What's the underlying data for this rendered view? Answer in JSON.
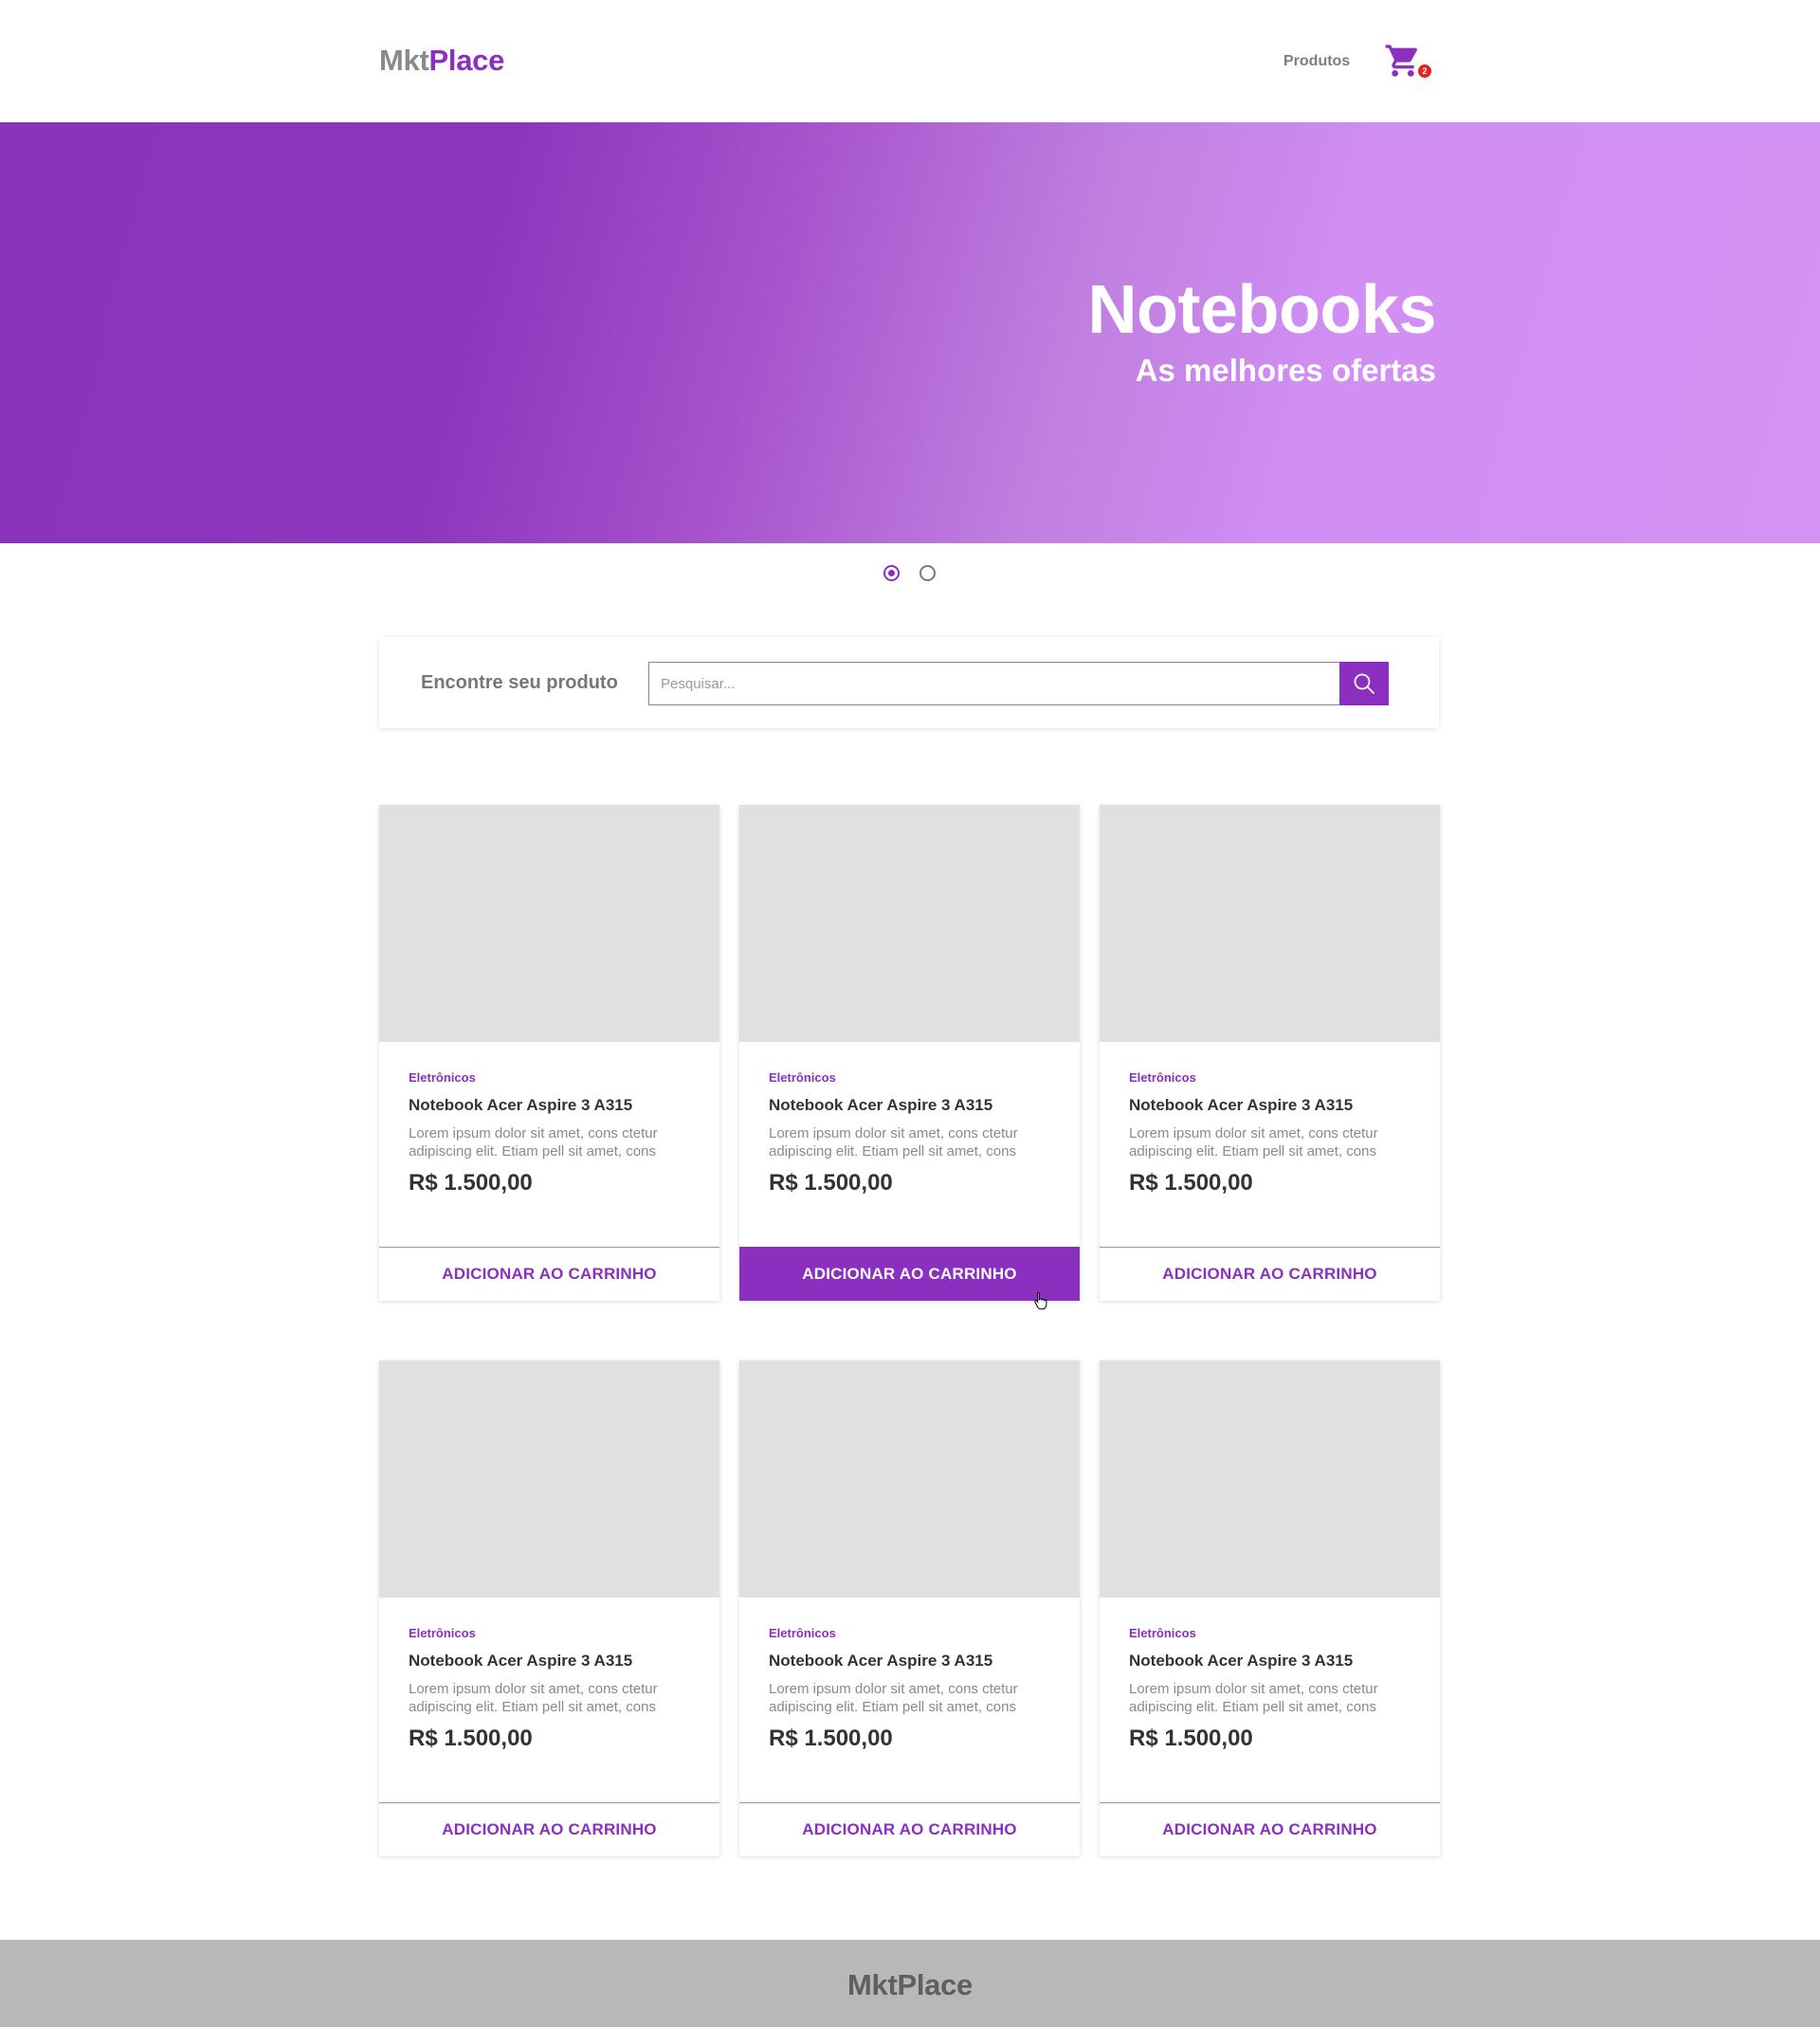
{
  "header": {
    "logo_part1": "Mkt",
    "logo_part2": "Place",
    "nav_products": "Produtos",
    "cart_count": "2"
  },
  "hero": {
    "title": "Notebooks",
    "subtitle": "As melhores ofertas",
    "slides": 2,
    "active_slide": 1
  },
  "search": {
    "label": "Encontre seu produto",
    "placeholder": "Pesquisar..."
  },
  "products": [
    {
      "category": "Eletrônicos",
      "title": "Notebook Acer Aspire 3 A315",
      "description": "Lorem ipsum dolor sit amet, cons ctetur adipiscing elit. Etiam pell sit amet, cons",
      "price": "R$ 1.500,00",
      "button": "ADICIONAR AO CARRINHO"
    },
    {
      "category": "Eletrônicos",
      "title": "Notebook Acer Aspire 3 A315",
      "description": "Lorem ipsum dolor sit amet, cons ctetur adipiscing elit. Etiam pell sit amet, cons",
      "price": "R$ 1.500,00",
      "button": "ADICIONAR AO CARRINHO"
    },
    {
      "category": "Eletrônicos",
      "title": "Notebook Acer Aspire 3 A315",
      "description": "Lorem ipsum dolor sit amet, cons ctetur adipiscing elit. Etiam pell sit amet, cons",
      "price": "R$ 1.500,00",
      "button": "ADICIONAR AO CARRINHO"
    },
    {
      "category": "Eletrônicos",
      "title": "Notebook Acer Aspire 3 A315",
      "description": "Lorem ipsum dolor sit amet, cons ctetur adipiscing elit. Etiam pell sit amet, cons",
      "price": "R$ 1.500,00",
      "button": "ADICIONAR AO CARRINHO"
    },
    {
      "category": "Eletrônicos",
      "title": "Notebook Acer Aspire 3 A315",
      "description": "Lorem ipsum dolor sit amet, cons ctetur adipiscing elit. Etiam pell sit amet, cons",
      "price": "R$ 1.500,00",
      "button": "ADICIONAR AO CARRINHO"
    },
    {
      "category": "Eletrônicos",
      "title": "Notebook Acer Aspire 3 A315",
      "description": "Lorem ipsum dolor sit amet, cons ctetur adipiscing elit. Etiam pell sit amet, cons",
      "price": "R$ 1.500,00",
      "button": "ADICIONAR AO CARRINHO"
    }
  ],
  "footer": {
    "logo": "MktPlace"
  },
  "colors": {
    "brand": "#8a2fbf",
    "badge": "#e02424",
    "footer_bg": "#b8b8b8",
    "image_placeholder": "#e0e0e0"
  },
  "icons": {
    "cart": "cart-icon",
    "search": "search-icon",
    "cursor": "hand-cursor-icon"
  }
}
